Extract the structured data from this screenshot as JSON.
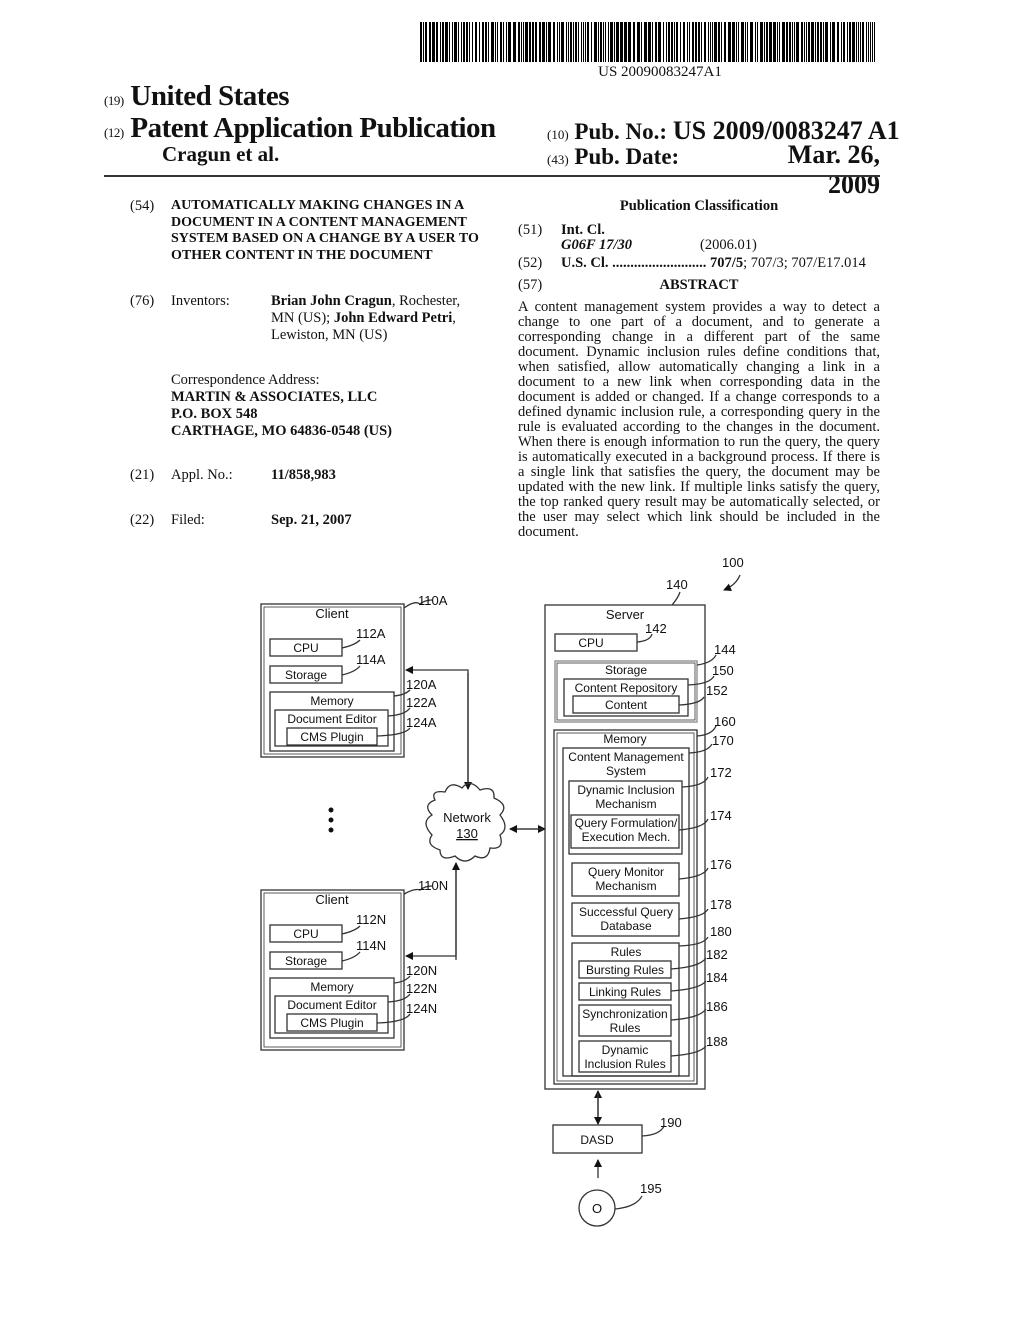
{
  "header": {
    "barcode_number": "US 20090083247A1",
    "country_code": "(19)",
    "country": "United States",
    "pub_type_code": "(12)",
    "pub_type": "Patent Application Publication",
    "authors": "Cragun et al.",
    "pub_no_code": "(10)",
    "pub_no_label": "Pub. No.:",
    "pub_no": "US 2009/0083247 A1",
    "pub_date_code": "(43)",
    "pub_date_label": "Pub. Date:",
    "pub_date": "Mar. 26, 2009"
  },
  "left": {
    "title_code": "(54)",
    "title": "AUTOMATICALLY MAKING CHANGES IN A DOCUMENT IN A CONTENT MANAGEMENT SYSTEM BASED ON A CHANGE BY A USER TO OTHER CONTENT IN THE DOCUMENT",
    "inventors_code": "(76)",
    "inventors_label": "Inventors:",
    "inventor1_name": "Brian John Cragun",
    "inventor1_loc": ", Rochester,",
    "inventor1_loc2": "MN (US); ",
    "inventor2_name": "John Edward Petri",
    "inventor2_loc": ",",
    "inventor2_loc2": "Lewiston, MN (US)",
    "correspondence_label": "Correspondence Address:",
    "correspondence_lines": [
      "MARTIN & ASSOCIATES, LLC",
      "P.O. BOX 548",
      "CARTHAGE, MO 64836-0548 (US)"
    ],
    "appl_code": "(21)",
    "appl_label": "Appl. No.:",
    "appl_no": "11/858,983",
    "filed_code": "(22)",
    "filed_label": "Filed:",
    "filed_date": "Sep. 21, 2007"
  },
  "right": {
    "pub_class_heading": "Publication Classification",
    "int_cl_code": "(51)",
    "int_cl_label": "Int. Cl.",
    "int_cl_value": "G06F 17/30",
    "int_cl_version": "(2006.01)",
    "us_cl_code": "(52)",
    "us_cl_label": "U.S. Cl. ..........................",
    "us_cl_primary": "707/5",
    "us_cl_rest": "; 707/3; 707/E17.014",
    "abstract_code": "(57)",
    "abstract_heading": "ABSTRACT",
    "abstract_text": "A content management system provides a way to detect a change to one part of a document, and to generate a corresponding change in a different part of the same document. Dynamic inclusion rules define conditions that, when satisfied, allow automatically changing a link in a document to a new link when corresponding data in the document is added or changed. If a change corresponds to a defined dynamic inclusion rule, a corresponding query in the rule is evaluated according to the changes in the document. When there is enough information to run the query, the query is automatically executed in a background process. If there is a single link that satisfies the query, the document may be updated with the new link. If multiple links satisfy the query, the top ranked query result may be automatically selected, or the user may select which link should be included in the document."
  },
  "diagram": {
    "system_ref": "100",
    "client_a": {
      "ref": "110A",
      "title": "Client",
      "cpu": "CPU",
      "cpu_ref": "112A",
      "storage": "Storage",
      "storage_ref": "114A",
      "memory": "Memory",
      "memory_ref": "120A",
      "editor": "Document Editor",
      "editor_ref": "122A",
      "plugin": "CMS Plugin",
      "plugin_ref": "124A"
    },
    "client_n": {
      "ref": "110N",
      "title": "Client",
      "cpu": "CPU",
      "cpu_ref": "112N",
      "storage": "Storage",
      "storage_ref": "114N",
      "memory": "Memory",
      "memory_ref": "120N",
      "editor": "Document Editor",
      "editor_ref": "122N",
      "plugin": "CMS Plugin",
      "plugin_ref": "124N"
    },
    "network": {
      "label": "Network",
      "ref": "130"
    },
    "server": {
      "ref": "140",
      "title": "Server",
      "cpu": "CPU",
      "cpu_ref": "142",
      "storage": "Storage",
      "storage_ref": "144",
      "repo": "Content Repository",
      "repo_ref": "150",
      "content": "Content",
      "content_ref": "152",
      "memory": "Memory",
      "memory_ref": "160",
      "cms_line1": "Content Management",
      "cms_line2": "System",
      "cms_ref": "170",
      "dim_line1": "Dynamic Inclusion",
      "dim_line2": "Mechanism",
      "dim_ref": "172",
      "qf_line1": "Query Formulation/",
      "qf_line2": "Execution Mech.",
      "qf_ref": "174",
      "qm_line1": "Query Monitor",
      "qm_line2": "Mechanism",
      "qm_ref": "176",
      "sqd_line1": "Successful Query",
      "sqd_line2": "Database",
      "sqd_ref": "178",
      "rules": "Rules",
      "rules_ref": "180",
      "bursting": "Bursting Rules",
      "bursting_ref": "182",
      "linking": "Linking Rules",
      "linking_ref": "184",
      "sync_line1": "Synchronization",
      "sync_line2": "Rules",
      "sync_ref": "186",
      "dir_line1": "Dynamic",
      "dir_line2": "Inclusion Rules",
      "dir_ref": "188"
    },
    "dasd": {
      "label": "DASD",
      "ref": "190"
    },
    "disk": {
      "label": "O",
      "ref": "195"
    }
  }
}
